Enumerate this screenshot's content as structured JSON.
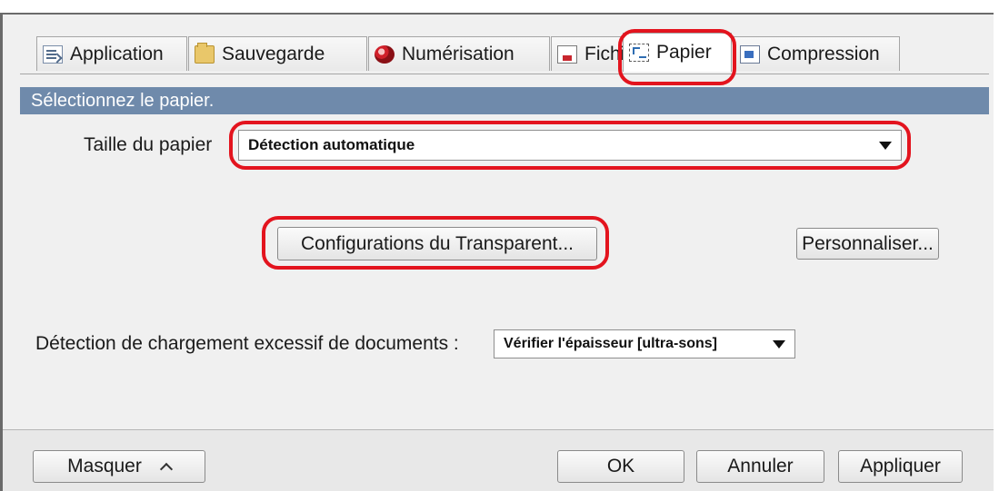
{
  "tabs": [
    {
      "label": "Application",
      "icon": "application-icon"
    },
    {
      "label": "Sauvegarde",
      "icon": "folder-icon"
    },
    {
      "label": "Numérisation",
      "icon": "scan-icon"
    },
    {
      "label": "Fichier",
      "icon": "file-icon"
    },
    {
      "label": "Papier",
      "icon": "paper-icon",
      "active": true
    },
    {
      "label": "Compression",
      "icon": "compression-icon"
    }
  ],
  "section": {
    "title": "Sélectionnez le papier."
  },
  "paper_size": {
    "label": "Taille du papier",
    "value": "Détection automatique"
  },
  "buttons": {
    "transparent": "Configurations du Transparent...",
    "customize": "Personnaliser..."
  },
  "overload": {
    "label": "Détection de chargement excessif de documents :",
    "value": "Vérifier l'épaisseur [ultra-sons]"
  },
  "footer": {
    "hide": "Masquer",
    "ok": "OK",
    "cancel": "Annuler",
    "apply": "Appliquer"
  },
  "colors": {
    "highlight": "#e3141e",
    "header": "#6f8aab"
  }
}
